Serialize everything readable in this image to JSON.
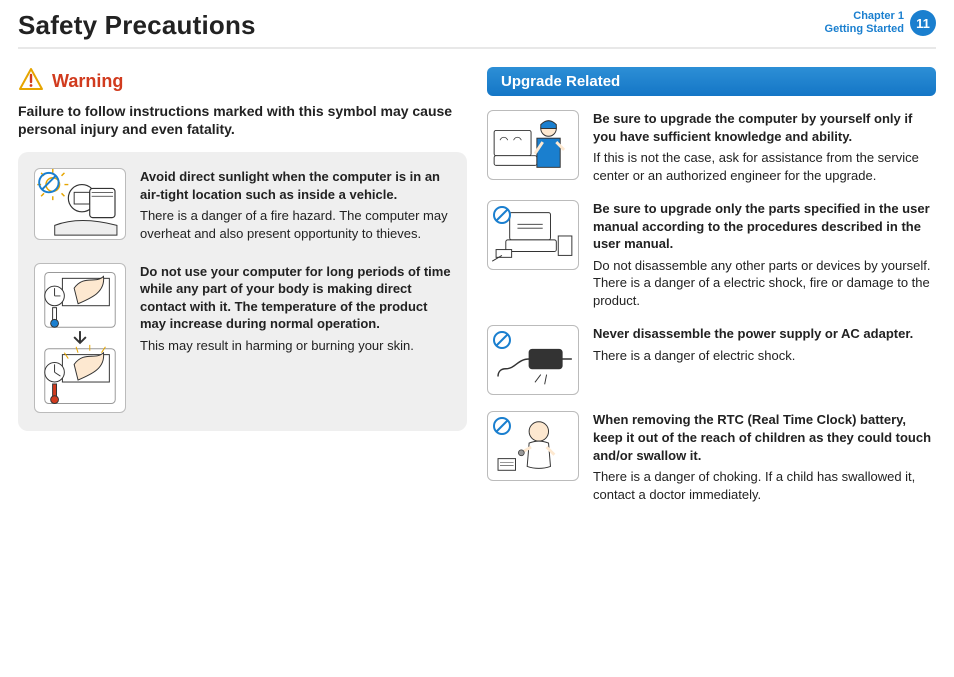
{
  "header": {
    "title": "Safety Precautions",
    "chapter_line1": "Chapter 1",
    "chapter_line2": "Getting Started",
    "page_number": "11"
  },
  "warning": {
    "label": "Warning",
    "intro": "Failure to follow instructions marked with this symbol may cause personal injury and even fatality."
  },
  "left_items": [
    {
      "bold": "Avoid direct sunlight when the computer is in an air-tight location such as inside a vehicle.",
      "body": "There is a danger of a fire hazard. The computer may overheat and also present opportunity to thieves."
    },
    {
      "bold": "Do not use your computer for long periods of time while any part of your body is making direct contact with it. The temperature of the product may increase during normal operation.",
      "body": "This may result in harming or burning your skin."
    }
  ],
  "right": {
    "section_title": "Upgrade Related",
    "items": [
      {
        "bold": "Be sure to upgrade the computer by yourself only if you have sufficient knowledge and ability.",
        "body": "If this is not the case, ask for assistance from the service center or an authorized engineer for the upgrade."
      },
      {
        "bold": "Be sure to upgrade only the parts specified in the user manual according to the procedures described in the user manual.",
        "body": "Do not disassemble any other parts or devices by yourself. There is a danger of a electric shock, fire or damage to the product."
      },
      {
        "bold": "Never disassemble the power supply or AC adapter.",
        "body": "There is a danger of electric shock."
      },
      {
        "bold": "When removing the RTC (Real Time Clock) battery, keep it out of the reach of children as they could touch and/or swallow it.",
        "body": "There is a danger of choking. If a child has swallowed it, contact a doctor immediately."
      }
    ]
  }
}
